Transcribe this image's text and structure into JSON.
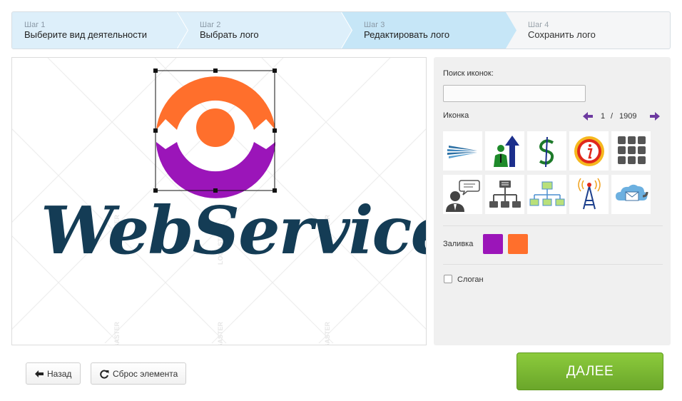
{
  "steps": [
    {
      "num": "Шаг 1",
      "title": "Выберите вид деятельности"
    },
    {
      "num": "Шаг 2",
      "title": "Выбрать лого"
    },
    {
      "num": "Шаг 3",
      "title": "Редактировать лого"
    },
    {
      "num": "Шаг 4",
      "title": "Сохранить лого"
    }
  ],
  "canvas": {
    "logo_text": "WebService",
    "watermark": "LOGASTER",
    "logo_colors": {
      "top": "#ff6f2c",
      "bottom": "#9b15b9",
      "text": "#143c55"
    }
  },
  "panel": {
    "search_label": "Поиск иконок:",
    "search_value": "",
    "icon_label": "Иконка",
    "pager": {
      "current": "1",
      "separator": "/",
      "total": "1909"
    },
    "icons": [
      "speed-lines-icon",
      "businessman-arrow-icon",
      "dollar-sign-icon",
      "info-icon",
      "grid-icon",
      "chat-person-icon",
      "org-chart-icon",
      "network-icon",
      "antenna-icon",
      "cloud-mail-icon"
    ],
    "fill_label": "Заливка",
    "fill_colors": [
      "#9b15b9",
      "#ff6f2c"
    ],
    "slogan_label": "Слоган",
    "slogan_checked": false
  },
  "buttons": {
    "back": "Назад",
    "reset": "Сброс элемента",
    "next": "ДАЛЕЕ"
  }
}
